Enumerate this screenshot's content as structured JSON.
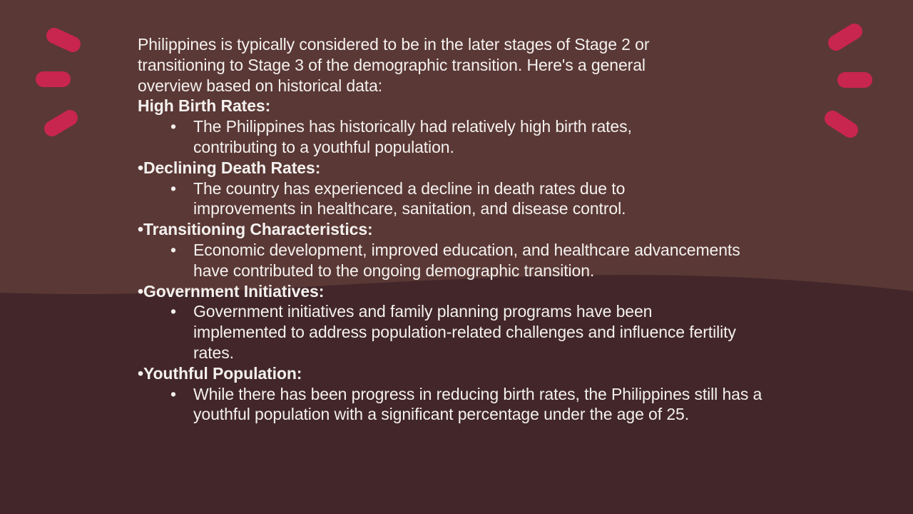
{
  "colors": {
    "background_top": "#5a3835",
    "background_bottom": "#42262a",
    "accent": "#c8254f",
    "text": "#f4f1ef"
  },
  "slide": {
    "intro": "Philippines is typically considered to be in the later stages of Stage 2 or transitioning to Stage 3 of the demographic transition. Here's a general overview based on historical data:",
    "bullet_symbol": "•",
    "sections": [
      {
        "heading": "High Birth Rates:",
        "points": [
          "The Philippines has historically had relatively high birth rates, contributing to a youthful population."
        ]
      },
      {
        "heading": "•Declining Death Rates:",
        "points": [
          "The country has experienced a decline in death rates due to improvements in healthcare, sanitation, and disease control."
        ]
      },
      {
        "heading": "•Transitioning Characteristics:",
        "points": [
          "Economic development, improved education, and healthcare advancements have contributed to the ongoing demographic transition."
        ]
      },
      {
        "heading": "•Government Initiatives:",
        "points": [
          "Government initiatives and family planning programs have been implemented to address population-related challenges and influence fertility rates."
        ]
      },
      {
        "heading": "•Youthful Population:",
        "points": [
          "While there has been progress in reducing birth rates, the Philippines still has a youthful population with a significant percentage under the age of 25."
        ]
      }
    ]
  }
}
